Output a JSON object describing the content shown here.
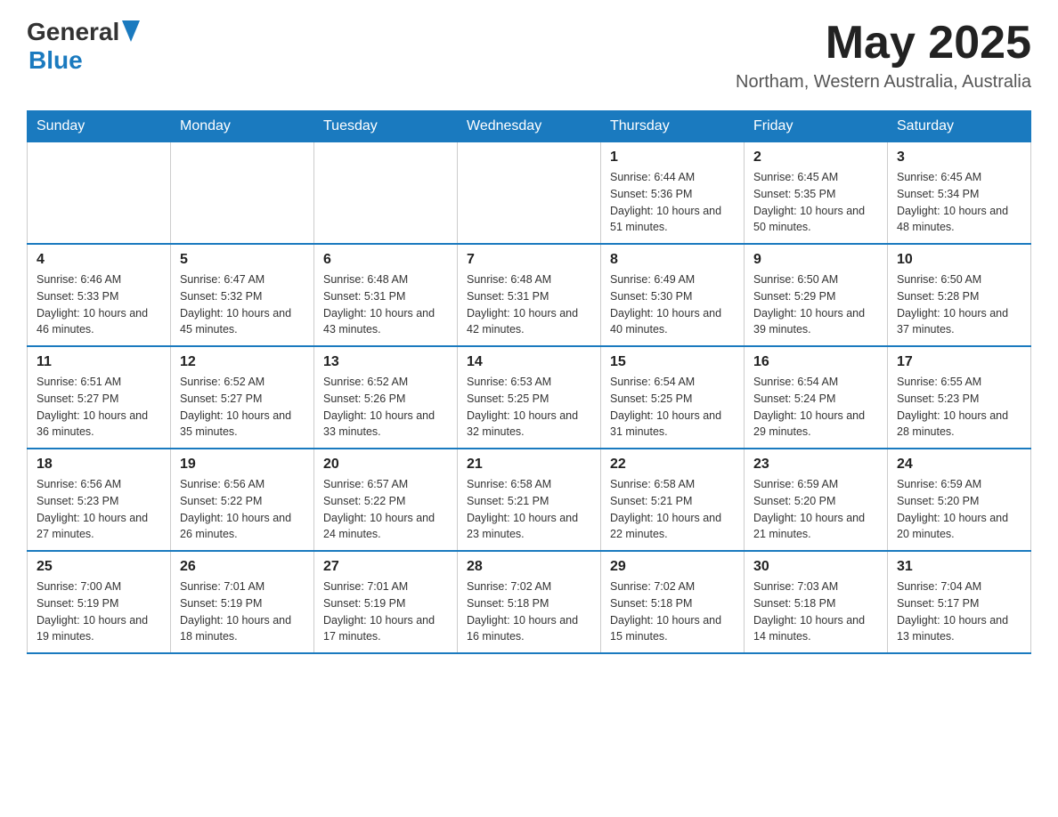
{
  "header": {
    "logo_general": "General",
    "logo_blue": "Blue",
    "month_year": "May 2025",
    "location": "Northam, Western Australia, Australia"
  },
  "weekdays": [
    "Sunday",
    "Monday",
    "Tuesday",
    "Wednesday",
    "Thursday",
    "Friday",
    "Saturday"
  ],
  "weeks": [
    [
      {
        "day": "",
        "info": ""
      },
      {
        "day": "",
        "info": ""
      },
      {
        "day": "",
        "info": ""
      },
      {
        "day": "",
        "info": ""
      },
      {
        "day": "1",
        "info": "Sunrise: 6:44 AM\nSunset: 5:36 PM\nDaylight: 10 hours and 51 minutes."
      },
      {
        "day": "2",
        "info": "Sunrise: 6:45 AM\nSunset: 5:35 PM\nDaylight: 10 hours and 50 minutes."
      },
      {
        "day": "3",
        "info": "Sunrise: 6:45 AM\nSunset: 5:34 PM\nDaylight: 10 hours and 48 minutes."
      }
    ],
    [
      {
        "day": "4",
        "info": "Sunrise: 6:46 AM\nSunset: 5:33 PM\nDaylight: 10 hours and 46 minutes."
      },
      {
        "day": "5",
        "info": "Sunrise: 6:47 AM\nSunset: 5:32 PM\nDaylight: 10 hours and 45 minutes."
      },
      {
        "day": "6",
        "info": "Sunrise: 6:48 AM\nSunset: 5:31 PM\nDaylight: 10 hours and 43 minutes."
      },
      {
        "day": "7",
        "info": "Sunrise: 6:48 AM\nSunset: 5:31 PM\nDaylight: 10 hours and 42 minutes."
      },
      {
        "day": "8",
        "info": "Sunrise: 6:49 AM\nSunset: 5:30 PM\nDaylight: 10 hours and 40 minutes."
      },
      {
        "day": "9",
        "info": "Sunrise: 6:50 AM\nSunset: 5:29 PM\nDaylight: 10 hours and 39 minutes."
      },
      {
        "day": "10",
        "info": "Sunrise: 6:50 AM\nSunset: 5:28 PM\nDaylight: 10 hours and 37 minutes."
      }
    ],
    [
      {
        "day": "11",
        "info": "Sunrise: 6:51 AM\nSunset: 5:27 PM\nDaylight: 10 hours and 36 minutes."
      },
      {
        "day": "12",
        "info": "Sunrise: 6:52 AM\nSunset: 5:27 PM\nDaylight: 10 hours and 35 minutes."
      },
      {
        "day": "13",
        "info": "Sunrise: 6:52 AM\nSunset: 5:26 PM\nDaylight: 10 hours and 33 minutes."
      },
      {
        "day": "14",
        "info": "Sunrise: 6:53 AM\nSunset: 5:25 PM\nDaylight: 10 hours and 32 minutes."
      },
      {
        "day": "15",
        "info": "Sunrise: 6:54 AM\nSunset: 5:25 PM\nDaylight: 10 hours and 31 minutes."
      },
      {
        "day": "16",
        "info": "Sunrise: 6:54 AM\nSunset: 5:24 PM\nDaylight: 10 hours and 29 minutes."
      },
      {
        "day": "17",
        "info": "Sunrise: 6:55 AM\nSunset: 5:23 PM\nDaylight: 10 hours and 28 minutes."
      }
    ],
    [
      {
        "day": "18",
        "info": "Sunrise: 6:56 AM\nSunset: 5:23 PM\nDaylight: 10 hours and 27 minutes."
      },
      {
        "day": "19",
        "info": "Sunrise: 6:56 AM\nSunset: 5:22 PM\nDaylight: 10 hours and 26 minutes."
      },
      {
        "day": "20",
        "info": "Sunrise: 6:57 AM\nSunset: 5:22 PM\nDaylight: 10 hours and 24 minutes."
      },
      {
        "day": "21",
        "info": "Sunrise: 6:58 AM\nSunset: 5:21 PM\nDaylight: 10 hours and 23 minutes."
      },
      {
        "day": "22",
        "info": "Sunrise: 6:58 AM\nSunset: 5:21 PM\nDaylight: 10 hours and 22 minutes."
      },
      {
        "day": "23",
        "info": "Sunrise: 6:59 AM\nSunset: 5:20 PM\nDaylight: 10 hours and 21 minutes."
      },
      {
        "day": "24",
        "info": "Sunrise: 6:59 AM\nSunset: 5:20 PM\nDaylight: 10 hours and 20 minutes."
      }
    ],
    [
      {
        "day": "25",
        "info": "Sunrise: 7:00 AM\nSunset: 5:19 PM\nDaylight: 10 hours and 19 minutes."
      },
      {
        "day": "26",
        "info": "Sunrise: 7:01 AM\nSunset: 5:19 PM\nDaylight: 10 hours and 18 minutes."
      },
      {
        "day": "27",
        "info": "Sunrise: 7:01 AM\nSunset: 5:19 PM\nDaylight: 10 hours and 17 minutes."
      },
      {
        "day": "28",
        "info": "Sunrise: 7:02 AM\nSunset: 5:18 PM\nDaylight: 10 hours and 16 minutes."
      },
      {
        "day": "29",
        "info": "Sunrise: 7:02 AM\nSunset: 5:18 PM\nDaylight: 10 hours and 15 minutes."
      },
      {
        "day": "30",
        "info": "Sunrise: 7:03 AM\nSunset: 5:18 PM\nDaylight: 10 hours and 14 minutes."
      },
      {
        "day": "31",
        "info": "Sunrise: 7:04 AM\nSunset: 5:17 PM\nDaylight: 10 hours and 13 minutes."
      }
    ]
  ]
}
